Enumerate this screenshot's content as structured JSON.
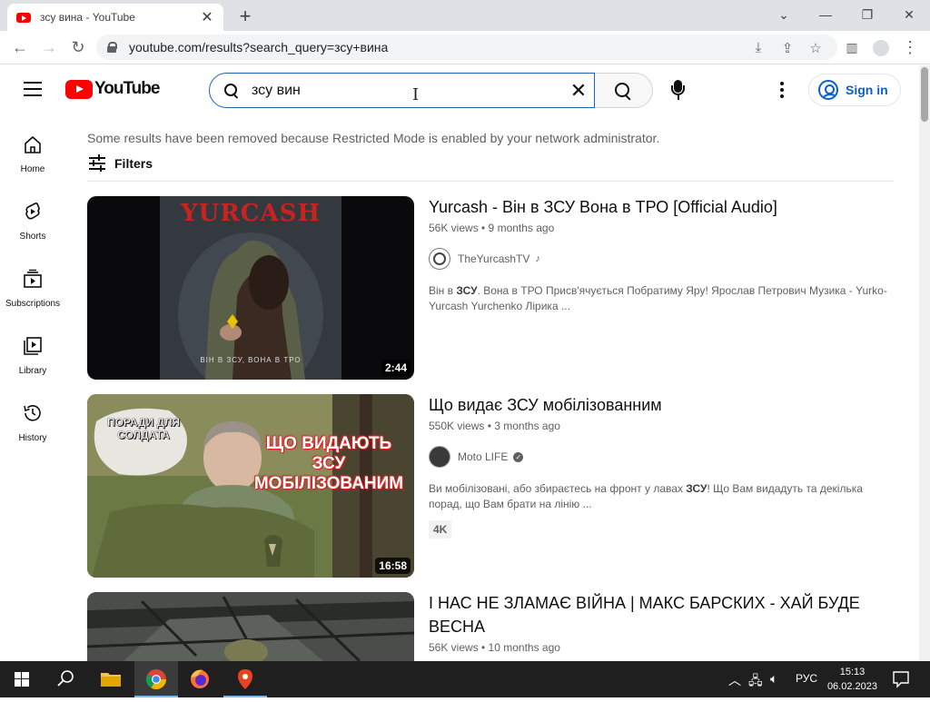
{
  "browser": {
    "tab_title": "зсу вина - YouTube",
    "url": "youtube.com/results?search_query=зсу+вина"
  },
  "header": {
    "logo_text": "YouTube",
    "search_value": "зсу вин",
    "sign_in": "Sign in"
  },
  "sidebar": {
    "items": [
      {
        "label": "Home",
        "icon": "home-icon"
      },
      {
        "label": "Shorts",
        "icon": "shorts-icon"
      },
      {
        "label": "Subscriptions",
        "icon": "subscriptions-icon"
      },
      {
        "label": "Library",
        "icon": "library-icon"
      },
      {
        "label": "History",
        "icon": "history-icon"
      }
    ]
  },
  "main": {
    "notice": "Some results have been removed because Restricted Mode is enabled by your network administrator.",
    "filters": "Filters",
    "results": [
      {
        "title": "Yurcash - Він в ЗСУ Вона в ТРО [Official Audio]",
        "meta": "56K views • 9 months ago",
        "channel": "TheYurcashTV",
        "channel_badge": "music-note-icon",
        "desc_pre": "Він в ",
        "desc_bold": "ЗСУ",
        "desc_post": ". Вона в ТРО Присв'ячується Побратиму Яру! Ярослав Петрович Музика - Yurko-Yurcash Yurchenko Лірика ...",
        "duration": "2:44",
        "thumb_title": "YURCASH",
        "thumb_sub": "ВІН В ЗСУ, ВОНА В ТРО"
      },
      {
        "title": "Що видає ЗСУ мобілізованним",
        "meta": "550K views • 3 months ago",
        "channel": "Moto LIFE",
        "channel_badge": "verified-icon",
        "desc_pre": "Ви мобілізовані, або збираєтесь на фронт у лавах ",
        "desc_bold": "ЗСУ",
        "desc_post": "! Що Вам видадуть та декілька порад, що Вам брати на лінію ...",
        "badge": "4K",
        "duration": "16:58",
        "thumb_bubble": "ПОРАДИ ДЛЯ СОЛДАТА",
        "thumb_text": "ЩО ВИДАЮТЬ ЗСУ МОБІЛІЗОВАНИМ"
      },
      {
        "title": "І НАС НЕ ЗЛАМАЄ ВІЙНА | МАКС БАРСКИХ - ХАЙ БУДЕ ВЕСНА",
        "meta": "56K views • 10 months ago"
      }
    ]
  },
  "taskbar": {
    "lang": "РУС",
    "time": "15:13",
    "date": "06.02.2023"
  }
}
